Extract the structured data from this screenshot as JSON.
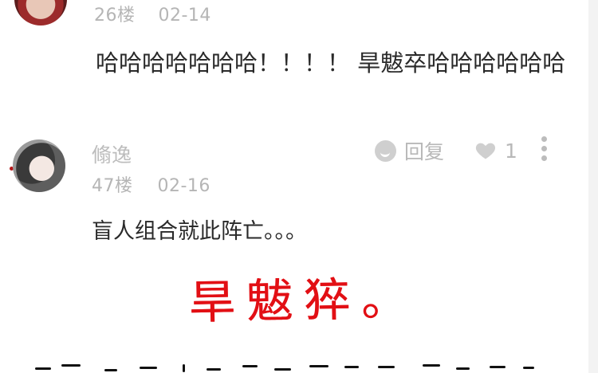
{
  "comments": [
    {
      "floor": "26楼",
      "date": "02-14",
      "text": "哈哈哈哈哈哈哈！！！！ 旱魃卒哈哈哈哈哈哈"
    },
    {
      "username": "翛逸",
      "floor": "47楼",
      "date": "02-16",
      "text": "盲人组合就此阵亡。。。",
      "reply_label": "回复",
      "like_count": "1"
    }
  ],
  "annotations": {
    "red_handwriting": "旱魃猝。"
  },
  "icons": {
    "reply": "reply-bubble-icon",
    "like": "heart-icon",
    "more": "vertical-ellipsis-icon"
  },
  "colors": {
    "meta_gray": "#b5b5b5",
    "text_dark": "#2a2a2a",
    "annotation_red": "#e20f14"
  }
}
